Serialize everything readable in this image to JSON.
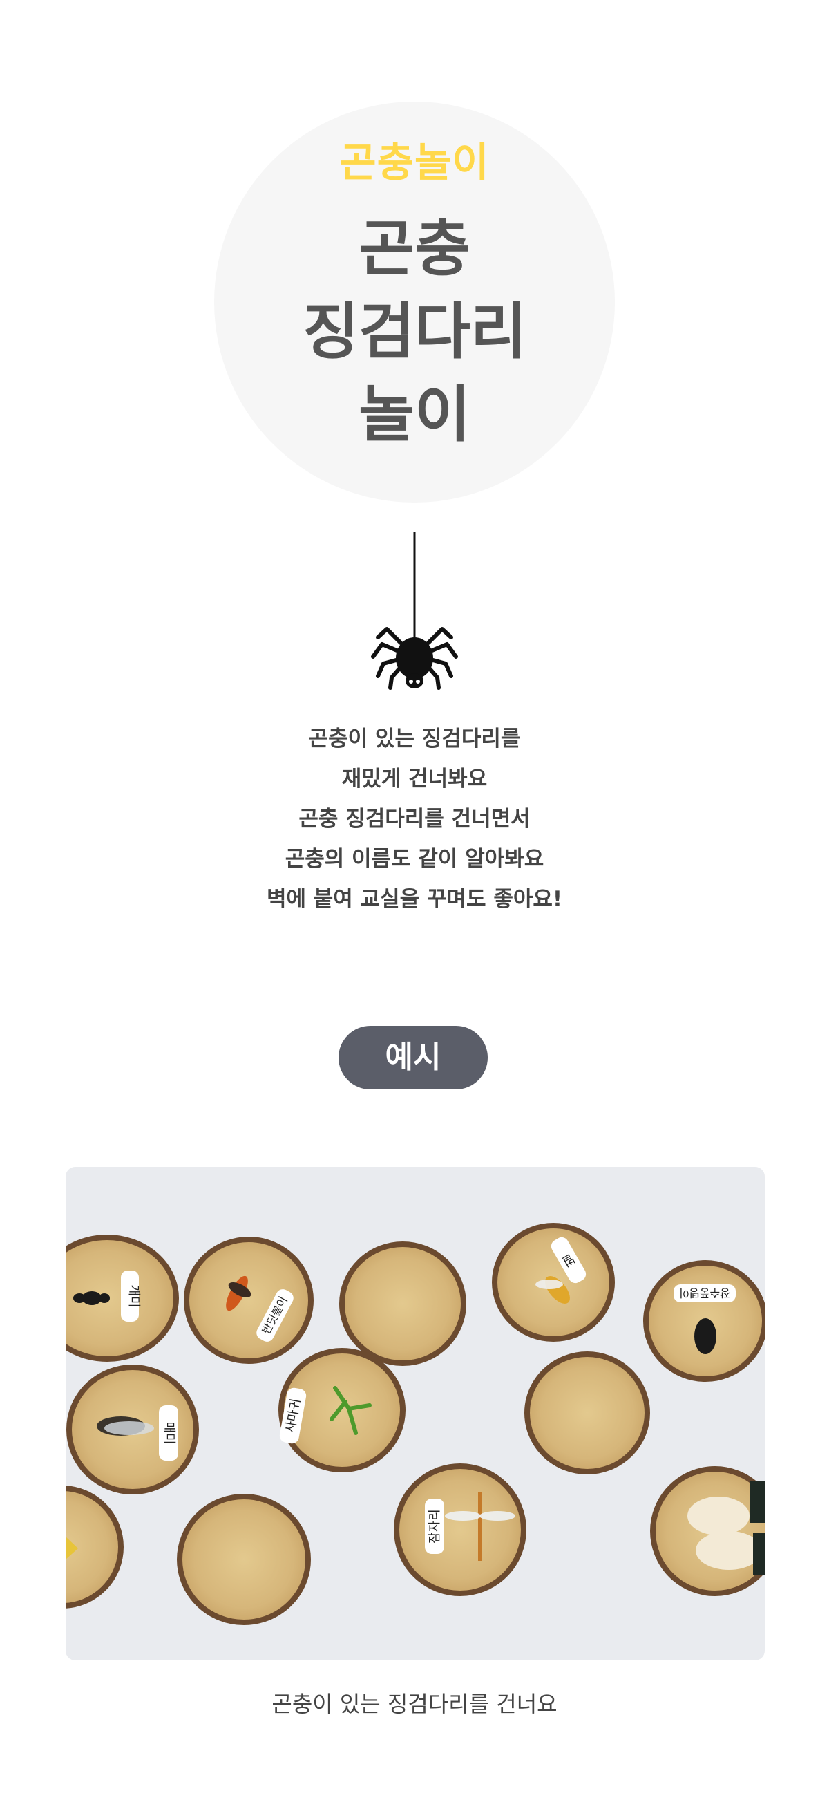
{
  "hero": {
    "subtitle": "곤충놀이",
    "title_lines": [
      "곤충",
      "징검다리",
      "놀이"
    ]
  },
  "description": [
    "곤충이 있는 징검다리를",
    "재밌게 건너봐요",
    "곤충 징검다리를 건너면서",
    "곤충의 이름도 같이 알아봐요",
    "벽에 붙여 교실을 꾸며도 좋아요!"
  ],
  "example_label": "예시",
  "photo": {
    "labels": [
      "개미",
      "반딧불이",
      "벌",
      "장수풍뎅이",
      "매미",
      "사마귀",
      "잠자리"
    ]
  },
  "caption": "곤충이 있는 징검다리를 건너요",
  "colors": {
    "accent": "#ffd84a",
    "title": "#555555",
    "pill": "#5b5e69",
    "hero_bg": "#f6f6f6"
  },
  "icons": [
    "spider-icon"
  ]
}
